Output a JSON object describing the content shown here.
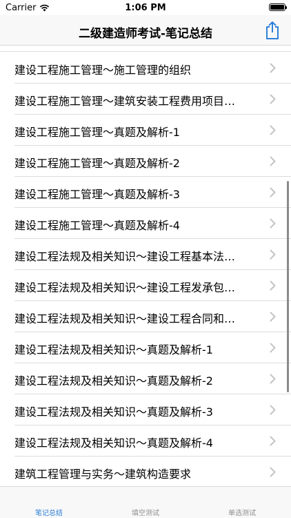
{
  "status_bar": {
    "carrier": "Carrier",
    "time": "1:06 PM"
  },
  "nav": {
    "title": "二级建造师考试-笔记总结"
  },
  "list": {
    "items": [
      {
        "label": "建设工程施工管理～施工管理的组织"
      },
      {
        "label": "建设工程施工管理～建筑安装工程费用项目…"
      },
      {
        "label": "建设工程施工管理～真题及解析-1"
      },
      {
        "label": "建设工程施工管理～真题及解析-2"
      },
      {
        "label": "建设工程施工管理～真题及解析-3"
      },
      {
        "label": "建设工程施工管理～真题及解析-4"
      },
      {
        "label": "建设工程法规及相关知识～建设工程基本法…"
      },
      {
        "label": "建设工程法规及相关知识～建设工程发承包…"
      },
      {
        "label": "建设工程法规及相关知识～建设工程合同和…"
      },
      {
        "label": "建设工程法规及相关知识～真题及解析-1"
      },
      {
        "label": "建设工程法规及相关知识～真题及解析-2"
      },
      {
        "label": "建设工程法规及相关知识～真题及解析-3"
      },
      {
        "label": "建设工程法规及相关知识～真题及解析-4"
      },
      {
        "label": "建筑工程管理与实务～建筑构造要求"
      }
    ]
  },
  "tabs": [
    {
      "label": "笔记总结"
    },
    {
      "label": "填空测试"
    },
    {
      "label": "单选测试"
    }
  ],
  "colors": {
    "accent": "#2f80d8",
    "inactive": "#8e8e93"
  }
}
